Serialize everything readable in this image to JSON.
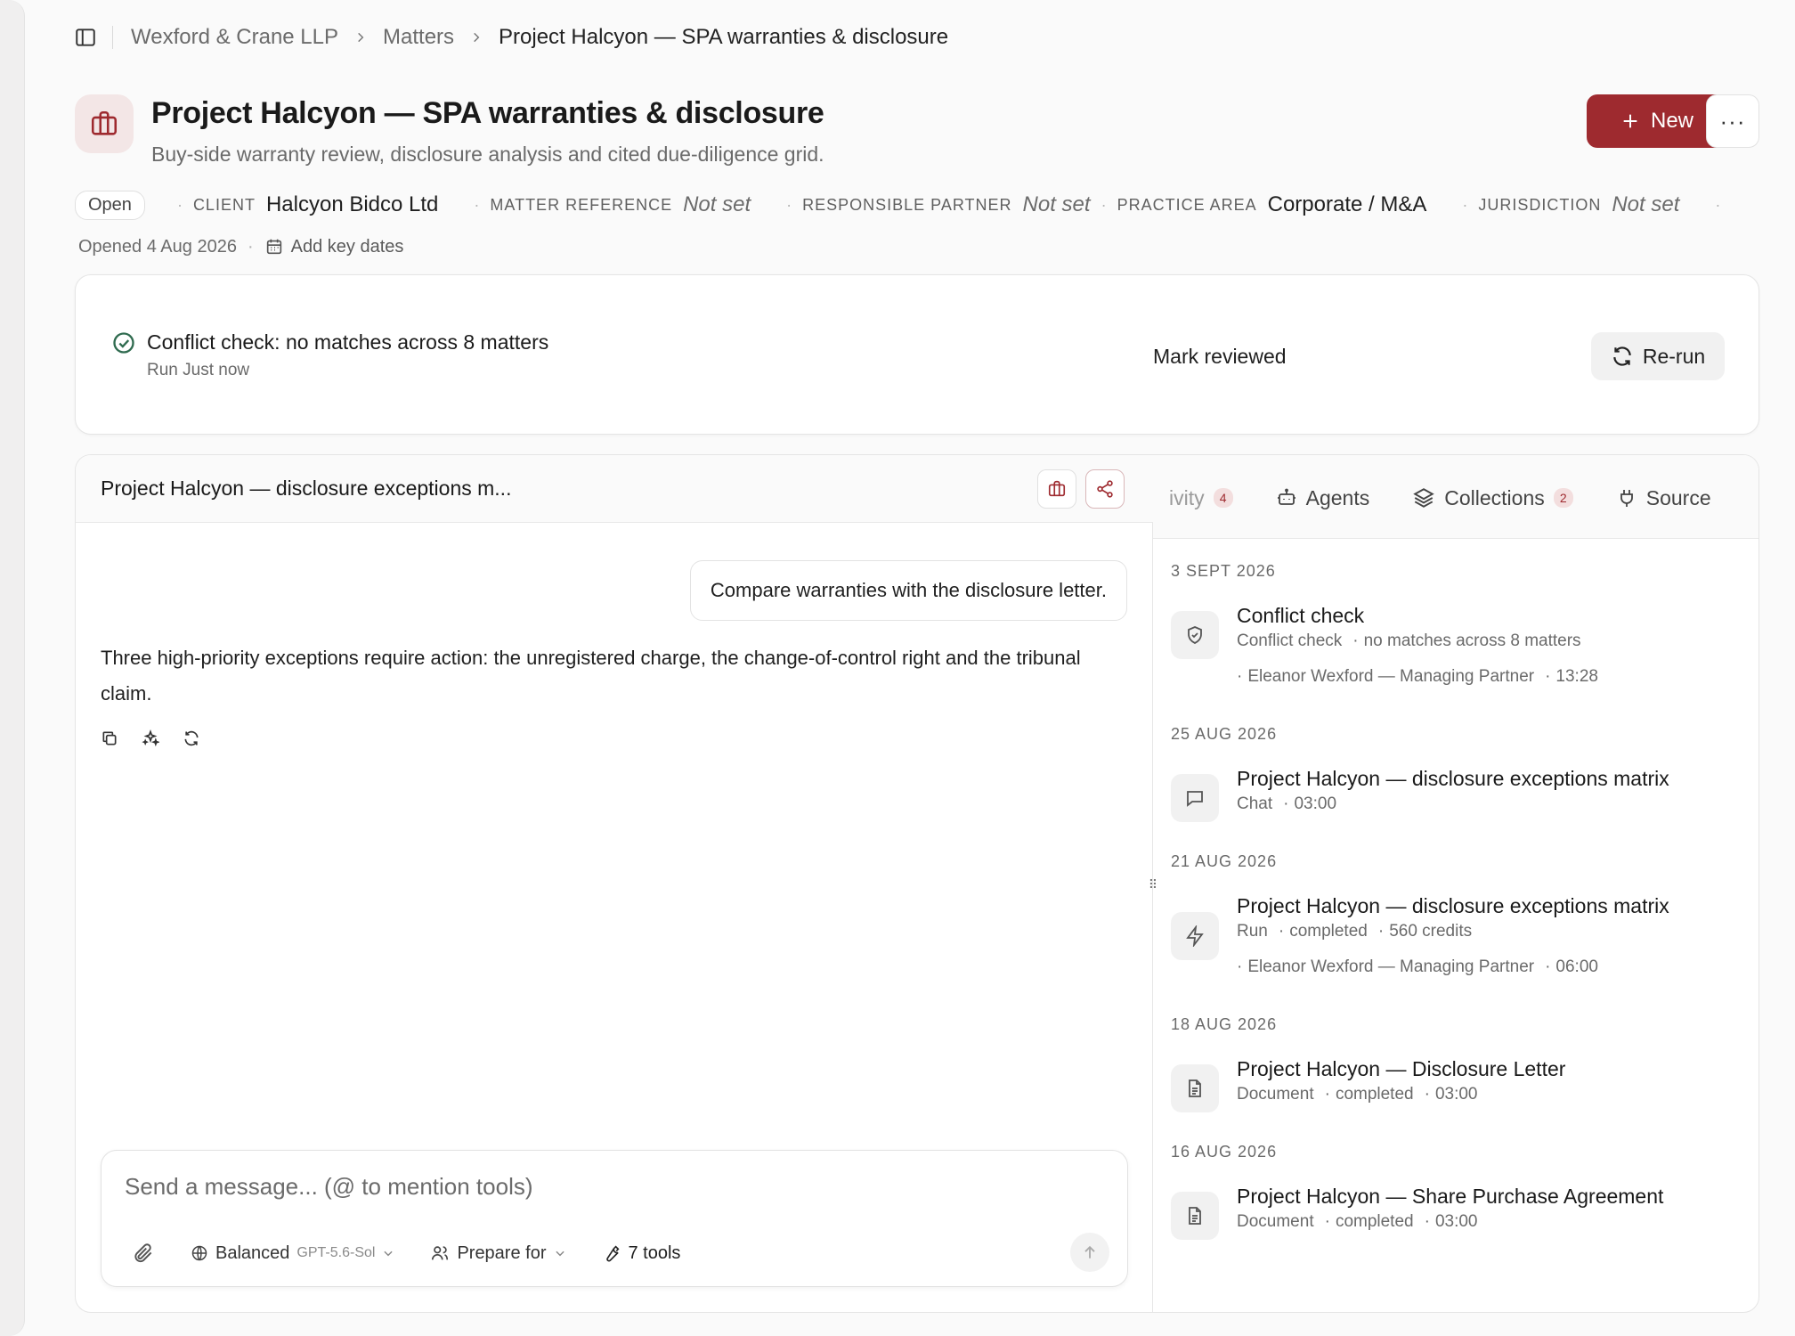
{
  "breadcrumb": {
    "items": [
      "Wexford & Crane LLP",
      "Matters",
      "Project Halcyon — SPA warranties & disclosure"
    ]
  },
  "header": {
    "title": "Project Halcyon — SPA warranties & disclosure",
    "description": "Buy-side warranty review, disclosure analysis and cited due-diligence grid.",
    "new_label": "New",
    "more_label": "···"
  },
  "meta": {
    "status": "Open",
    "client_label": "CLIENT",
    "client_value": "Halcyon Bidco Ltd",
    "matter_ref_label": "MATTER REFERENCE",
    "matter_ref_value": "Not set",
    "partner_label": "RESPONSIBLE PARTNER",
    "partner_value": "Not set",
    "practice_label": "PRACTICE AREA",
    "practice_value": "Corporate / M&A",
    "jurisdiction_label": "JURISDICTION",
    "jurisdiction_value": "Not set",
    "opened": "Opened 4 Aug 2026",
    "add_key_dates": "Add key dates"
  },
  "conflict": {
    "title": "Conflict check: no matches across 8 matters",
    "subtitle": "Run Just now",
    "mark_reviewed": "Mark reviewed",
    "rerun": "Re-run"
  },
  "chat": {
    "title": "Project Halcyon — disclosure exceptions m...",
    "user_message": "Compare warranties with the disclosure letter.",
    "assistant_message": "Three high-priority exceptions require action: the unregistered charge, the change-of-control right and the tribunal claim.",
    "composer_placeholder": "Send a message... (@ to mention tools)",
    "model_label": "Balanced",
    "model_name": "GPT-5.6-Sol",
    "prepare_for": "Prepare for",
    "tools": "7 tools"
  },
  "tabs": [
    {
      "label": "ivity",
      "badge": "4"
    },
    {
      "label": "Agents",
      "badge": ""
    },
    {
      "label": "Collections",
      "badge": "2"
    },
    {
      "label": "Source",
      "badge": ""
    }
  ],
  "activity": [
    {
      "date": "3 SEPT 2026",
      "icon": "shield-check-icon",
      "title": "Conflict check",
      "meta": [
        "Conflict check",
        "no matches across 8 matters"
      ],
      "meta2": [
        "Eleanor Wexford — Managing Partner",
        "13:28"
      ]
    },
    {
      "date": "25 AUG 2026",
      "icon": "chat-bubble-icon",
      "title": "Project Halcyon — disclosure exceptions matrix",
      "meta": [
        "Chat",
        "03:00"
      ],
      "meta2": []
    },
    {
      "date": "21 AUG 2026",
      "icon": "lightning-icon",
      "title": "Project Halcyon — disclosure exceptions matrix",
      "meta": [
        "Run",
        "completed",
        "560 credits"
      ],
      "meta2": [
        "Eleanor Wexford — Managing Partner",
        "06:00"
      ]
    },
    {
      "date": "18 AUG 2026",
      "icon": "document-icon",
      "title": "Project Halcyon — Disclosure Letter",
      "meta": [
        "Document",
        "completed",
        "03:00"
      ],
      "meta2": []
    },
    {
      "date": "16 AUG 2026",
      "icon": "document-icon",
      "title": "Project Halcyon — Share Purchase Agreement",
      "meta": [
        "Document",
        "completed",
        "03:00"
      ],
      "meta2": []
    }
  ],
  "colors": {
    "accent": "#9e2a2f",
    "badge_bg": "#f3dede",
    "success": "#2f6b4f"
  }
}
